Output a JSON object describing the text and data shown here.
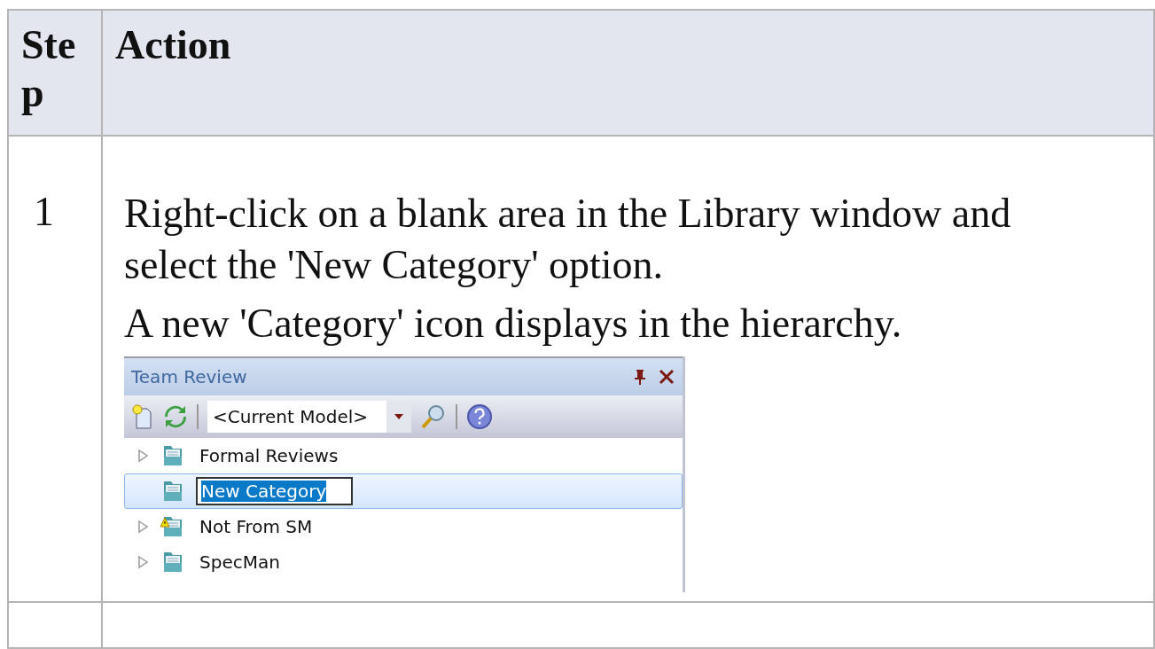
{
  "table": {
    "columns": [
      "Step",
      "Action"
    ],
    "rows": [
      {
        "step": "1",
        "lines": [
          "Right-click on a blank area in the Library window and select the 'New Category' option.",
          "A new 'Category' icon displays in the hierarchy."
        ],
        "panel": {
          "title": "Team Review",
          "model_select": "<Current Model>",
          "items": [
            {
              "label": "Formal Reviews",
              "expandable": true,
              "selected": false,
              "warning": false
            },
            {
              "label": "New Category",
              "expandable": false,
              "selected": true,
              "warning": false
            },
            {
              "label": "Not From SM",
              "expandable": true,
              "selected": false,
              "warning": true
            },
            {
              "label": "SpecMan",
              "expandable": true,
              "selected": false,
              "warning": false
            }
          ]
        }
      }
    ]
  }
}
